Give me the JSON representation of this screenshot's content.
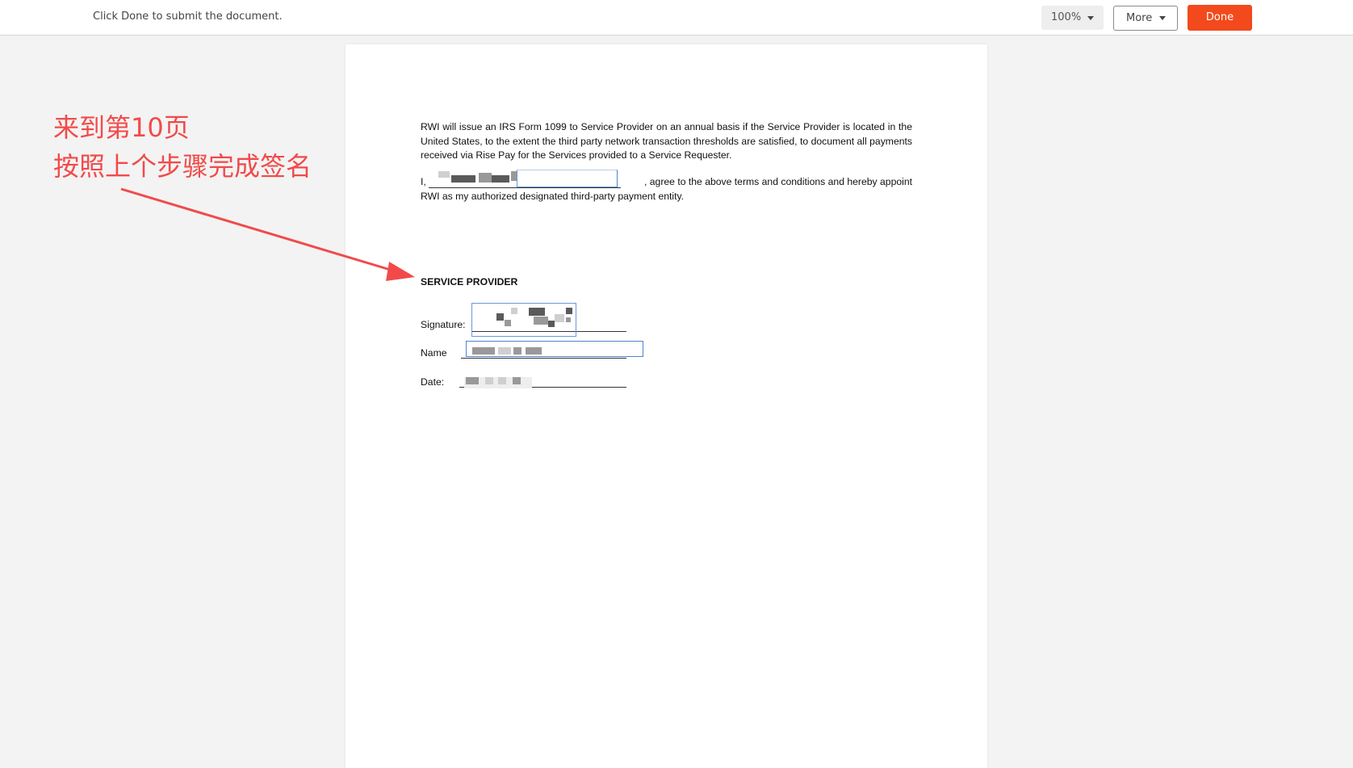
{
  "toolbar": {
    "instruction": "Click Done to submit the document.",
    "zoom_value": "100%",
    "more_label": "More",
    "done_label": "Done",
    "done_color": "#f24a1d"
  },
  "document": {
    "paragraph1": "RWI will issue an IRS Form 1099 to Service Provider on an annual basis if the Service Provider is located in the United States, to the extent the third party network transaction thresholds are satisfied, to document all payments received via Rise Pay for the Services provided to a Service Requester.",
    "para2_prefix": "I,",
    "para2_suffix": ", agree to the above terms and conditions and hereby appoint",
    "para2_line2": "RWI as my authorized designated third-party payment entity.",
    "heading": "SERVICE PROVIDER",
    "signature_label": "Signature:",
    "name_label": "Name",
    "date_label": "Date:"
  },
  "annotation": {
    "line1": "来到第10页",
    "line2": "按照上个步骤完成签名",
    "color": "#f24a4a"
  }
}
